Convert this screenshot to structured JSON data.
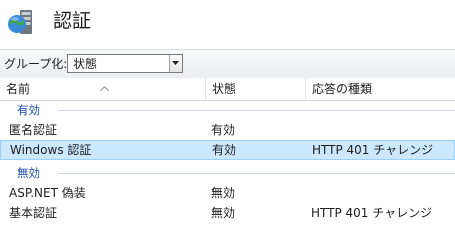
{
  "header": {
    "title": "認証",
    "icon": "server-globe-icon"
  },
  "toolbar": {
    "group_label": "グループ化:",
    "group_value": "状態"
  },
  "columns": [
    "名前",
    "状態",
    "応答の種類"
  ],
  "groups": [
    {
      "label": "有効",
      "rows": [
        {
          "name": "匿名認証",
          "status": "有効",
          "response": ""
        },
        {
          "name": "Windows 認証",
          "status": "有効",
          "response": "HTTP 401 チャレンジ",
          "selected": true
        }
      ]
    },
    {
      "label": "無効",
      "rows": [
        {
          "name": "ASP.NET 偽装",
          "status": "無効",
          "response": ""
        },
        {
          "name": "基本認証",
          "status": "無効",
          "response": "HTTP 401 チャレンジ"
        }
      ]
    }
  ],
  "colors": {
    "selection": "#cce8ff",
    "group_text": "#1a4bb0"
  }
}
